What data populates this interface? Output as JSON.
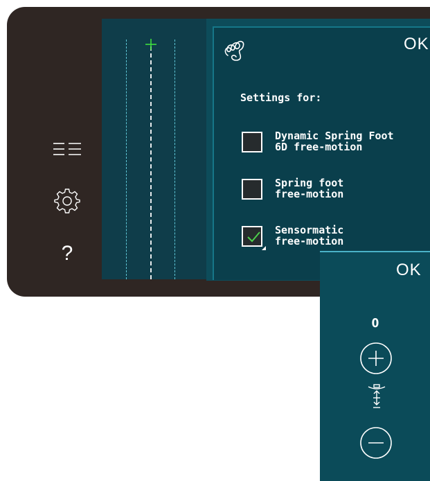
{
  "sidebar": {
    "items": [
      {
        "icon": "list-menu-icon"
      },
      {
        "icon": "gear-icon"
      },
      {
        "icon": "help-icon",
        "label": "?"
      }
    ]
  },
  "settings_dialog": {
    "app_icon": "free-motion-stitch-icon",
    "ok_label": "OK",
    "heading": "Settings for:",
    "options": [
      {
        "line1": "Dynamic Spring Foot",
        "line2": "6D free-motion",
        "checked": false
      },
      {
        "line1": "Spring foot",
        "line2": "free-motion",
        "checked": false
      },
      {
        "line1": "Sensormatic",
        "line2": "free-motion",
        "checked": true
      }
    ]
  },
  "adjust_panel": {
    "ok_label": "OK",
    "value": "0",
    "increase_icon": "plus-icon",
    "decrease_icon": "minus-icon",
    "foot_icon": "presser-foot-height-icon"
  },
  "colors": {
    "bezel": "#2f2623",
    "panel": "#0a3f4c",
    "accent": "#167789",
    "check_green": "#4ccf4c"
  }
}
